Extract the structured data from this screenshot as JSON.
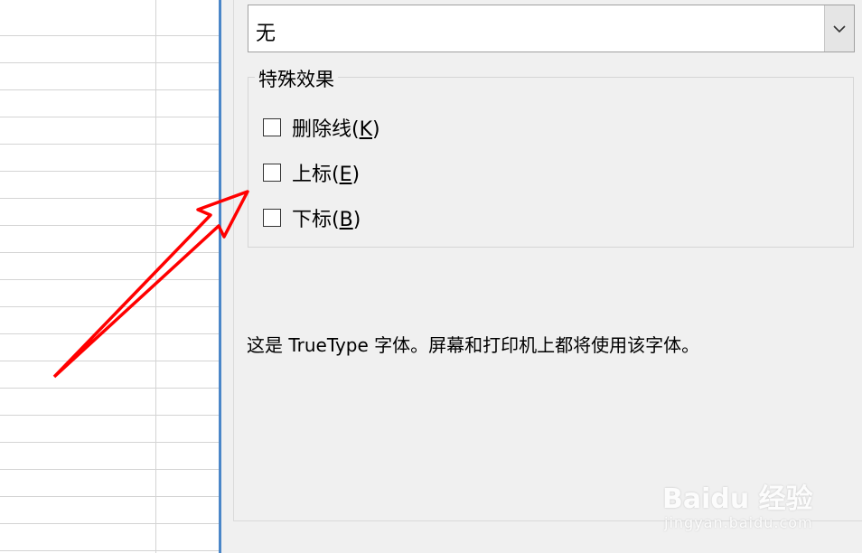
{
  "underline_dropdown": {
    "value": "无",
    "arrow_icon": "chevron-down-icon"
  },
  "effects": {
    "title": "特殊效果",
    "items": [
      {
        "text": "删除线(",
        "access_key": "K",
        "close": ")",
        "checked": false
      },
      {
        "text": "上标(",
        "access_key": "E",
        "close": ")",
        "checked": false
      },
      {
        "text": "下标(",
        "access_key": "B",
        "close": ")",
        "checked": false
      }
    ]
  },
  "font_info": "这是 TrueType 字体。屏幕和打印机上都将使用该字体。",
  "watermark": {
    "main": "Baidu 经验",
    "sub": "jingyan.baidu.com"
  },
  "colors": {
    "accent_border": "#4a86c8",
    "annotation_arrow": "#ff0000"
  }
}
